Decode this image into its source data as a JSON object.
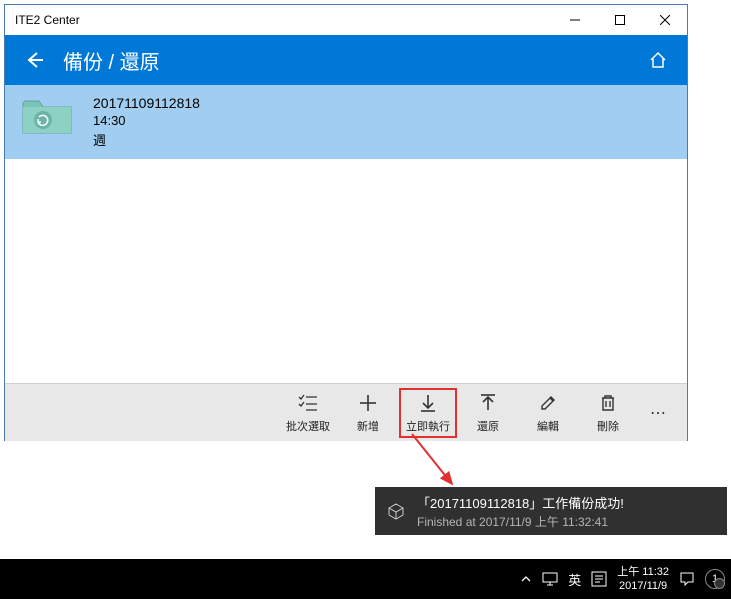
{
  "window": {
    "title": "ITE2 Center"
  },
  "header": {
    "title": "備份 / 還原"
  },
  "item": {
    "name": "20171109112818",
    "time": "14:30",
    "day": "週"
  },
  "toolbar": {
    "batch": "批次選取",
    "add": "新增",
    "execute": "立即執行",
    "restore": "還原",
    "edit": "編輯",
    "delete": "刪除"
  },
  "notification": {
    "title": "「20171109112818」工作備份成功!",
    "subtitle": "Finished at 2017/11/9 上午 11:32:41"
  },
  "taskbar": {
    "lang": "英",
    "time": "上午 11:32",
    "date": "2017/11/9",
    "badge": "1"
  }
}
